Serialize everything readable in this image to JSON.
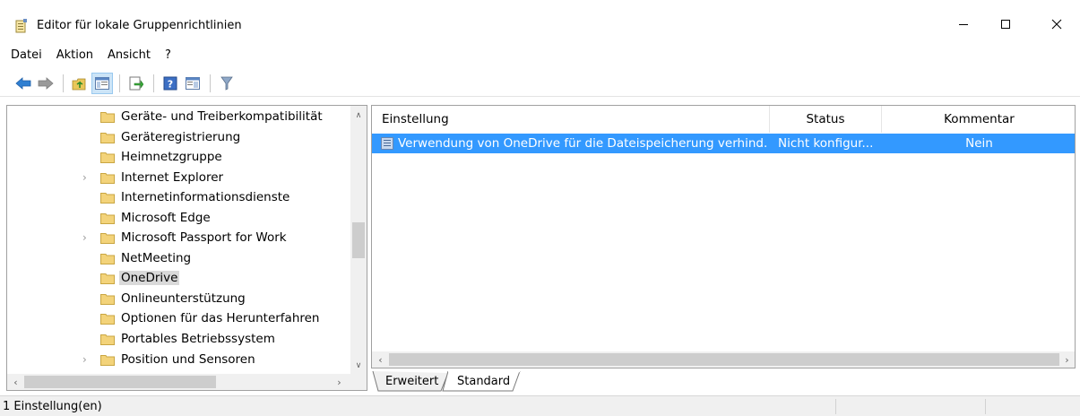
{
  "window": {
    "title": "Editor für lokale Gruppenrichtlinien",
    "min_glyph": "—",
    "max_glyph": "☐",
    "close_glyph": "✕"
  },
  "menu": {
    "items": [
      "Datei",
      "Aktion",
      "Ansicht",
      "?"
    ]
  },
  "toolbar": {
    "buttons": [
      "back-icon",
      "forward-icon",
      "up-folder-icon",
      "show-hide-tree-icon",
      "export-list-icon",
      "help-icon",
      "extended-view-icon",
      "filter-icon"
    ]
  },
  "tree": {
    "items": [
      {
        "label": "Geräte- und Treiberkompatibilität",
        "expandable": false
      },
      {
        "label": "Geräteregistrierung",
        "expandable": false
      },
      {
        "label": "Heimnetzgruppe",
        "expandable": false
      },
      {
        "label": "Internet Explorer",
        "expandable": true
      },
      {
        "label": "Internetinformationsdienste",
        "expandable": false
      },
      {
        "label": "Microsoft Edge",
        "expandable": false
      },
      {
        "label": "Microsoft Passport for Work",
        "expandable": true
      },
      {
        "label": "NetMeeting",
        "expandable": false
      },
      {
        "label": "OneDrive",
        "expandable": false,
        "selected": true
      },
      {
        "label": "Onlineunterstützung",
        "expandable": false
      },
      {
        "label": "Optionen für das Herunterfahren",
        "expandable": false
      },
      {
        "label": "Portables Betriebssystem",
        "expandable": false
      },
      {
        "label": "Position und Sensoren",
        "expandable": true
      }
    ]
  },
  "list": {
    "columns": {
      "setting": "Einstellung",
      "status": "Status",
      "comment": "Kommentar"
    },
    "rows": [
      {
        "setting": "Verwendung von OneDrive für die Dateispeicherung verhind...",
        "status": "Nicht konfigur...",
        "comment": "Nein",
        "selected": true
      }
    ]
  },
  "tabs": {
    "extended": "Erweitert",
    "standard": "Standard",
    "active": "Standard"
  },
  "status": {
    "text": "1 Einstellung(en)"
  },
  "colors": {
    "selection": "#3399ff",
    "folder": "#f3d37a"
  }
}
